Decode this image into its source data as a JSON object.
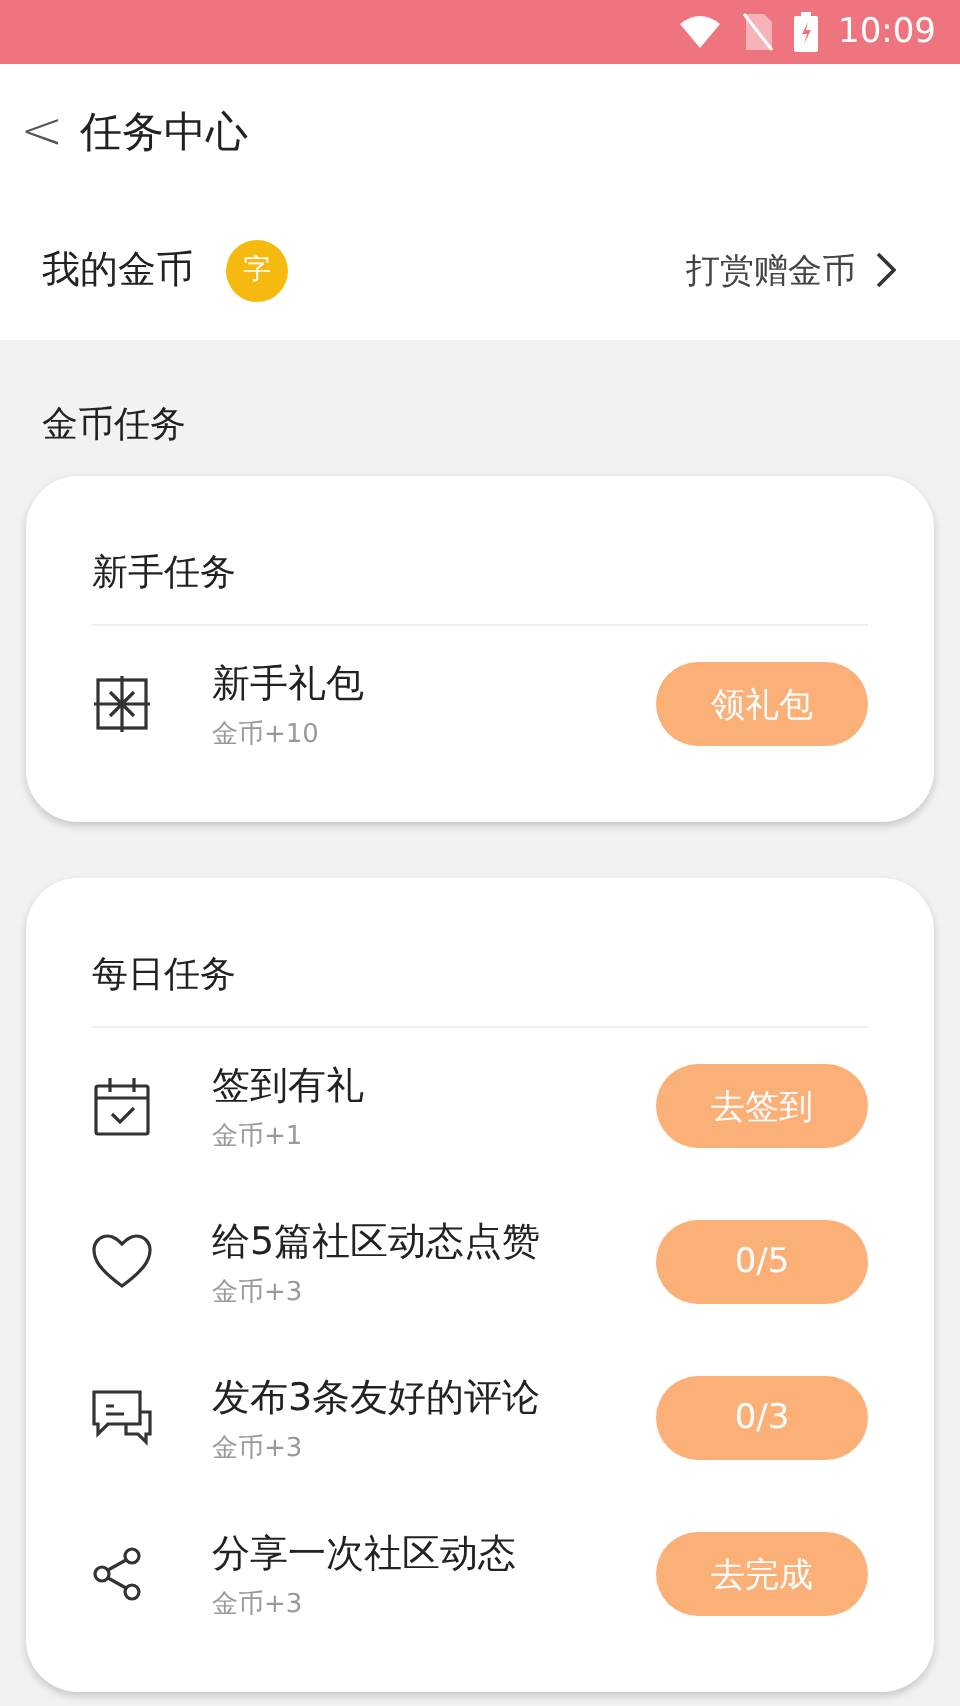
{
  "status_bar": {
    "time": "10:09"
  },
  "header": {
    "back": "<",
    "title": "任务中心"
  },
  "coins": {
    "label": "我的金币",
    "coin_glyph": "字",
    "link": "打赏赠金币"
  },
  "section_title": "金币任务",
  "cards": [
    {
      "title": "新手任务",
      "tasks": [
        {
          "kind": "gift",
          "name": "新手礼包",
          "reward": "金币+10",
          "action": "领礼包"
        }
      ]
    },
    {
      "title": "每日任务",
      "tasks": [
        {
          "kind": "calendar",
          "name": "签到有礼",
          "reward": "金币+1",
          "action": "去签到"
        },
        {
          "kind": "heart",
          "name": "给5篇社区动态点赞",
          "reward": "金币+3",
          "action": "0/5"
        },
        {
          "kind": "comment",
          "name": "发布3条友好的评论",
          "reward": "金币+3",
          "action": "0/3"
        },
        {
          "kind": "share",
          "name": "分享一次社区动态",
          "reward": "金币+3",
          "action": "去完成"
        }
      ]
    }
  ]
}
